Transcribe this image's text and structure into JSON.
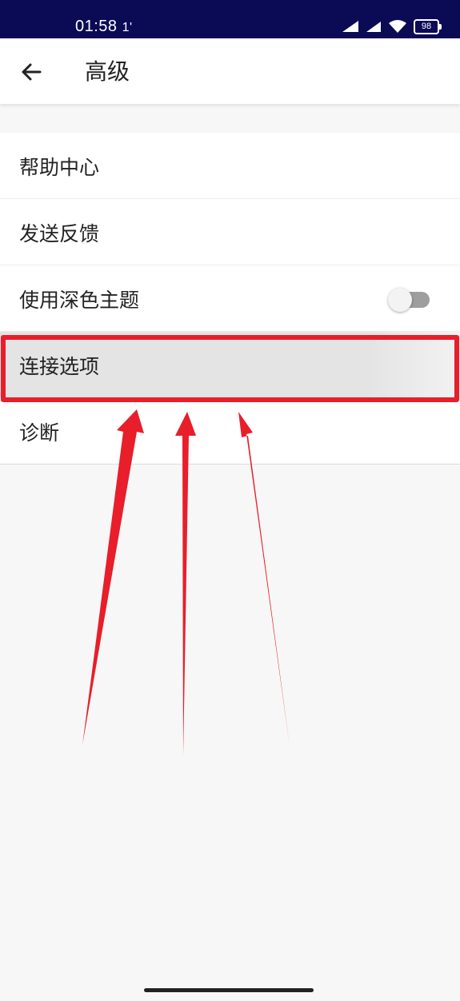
{
  "status_bar": {
    "time": "01:58",
    "extra": "1'",
    "battery": "98"
  },
  "header": {
    "title": "高级"
  },
  "settings": {
    "items": [
      {
        "label": "帮助中心"
      },
      {
        "label": "发送反馈"
      },
      {
        "label": "使用深色主题",
        "toggle_on": false
      },
      {
        "label": "连接选项",
        "highlighted": true
      },
      {
        "label": "诊断"
      }
    ]
  },
  "colors": {
    "status_bar": "#0b0b55",
    "annotation": "#e81e2a"
  }
}
